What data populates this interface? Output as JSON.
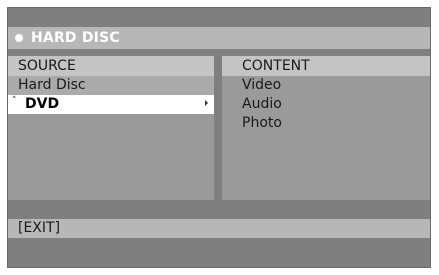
{
  "title": "HARD DISC",
  "source": {
    "header": "SOURCE",
    "items": [
      {
        "label": "Hard Disc"
      },
      {
        "label": "DVD"
      }
    ]
  },
  "content": {
    "header": "CONTENT",
    "items": [
      {
        "label": "Video"
      },
      {
        "label": "Audio"
      },
      {
        "label": "Photo"
      }
    ]
  },
  "footer": {
    "exit_label": "[EXIT]"
  }
}
